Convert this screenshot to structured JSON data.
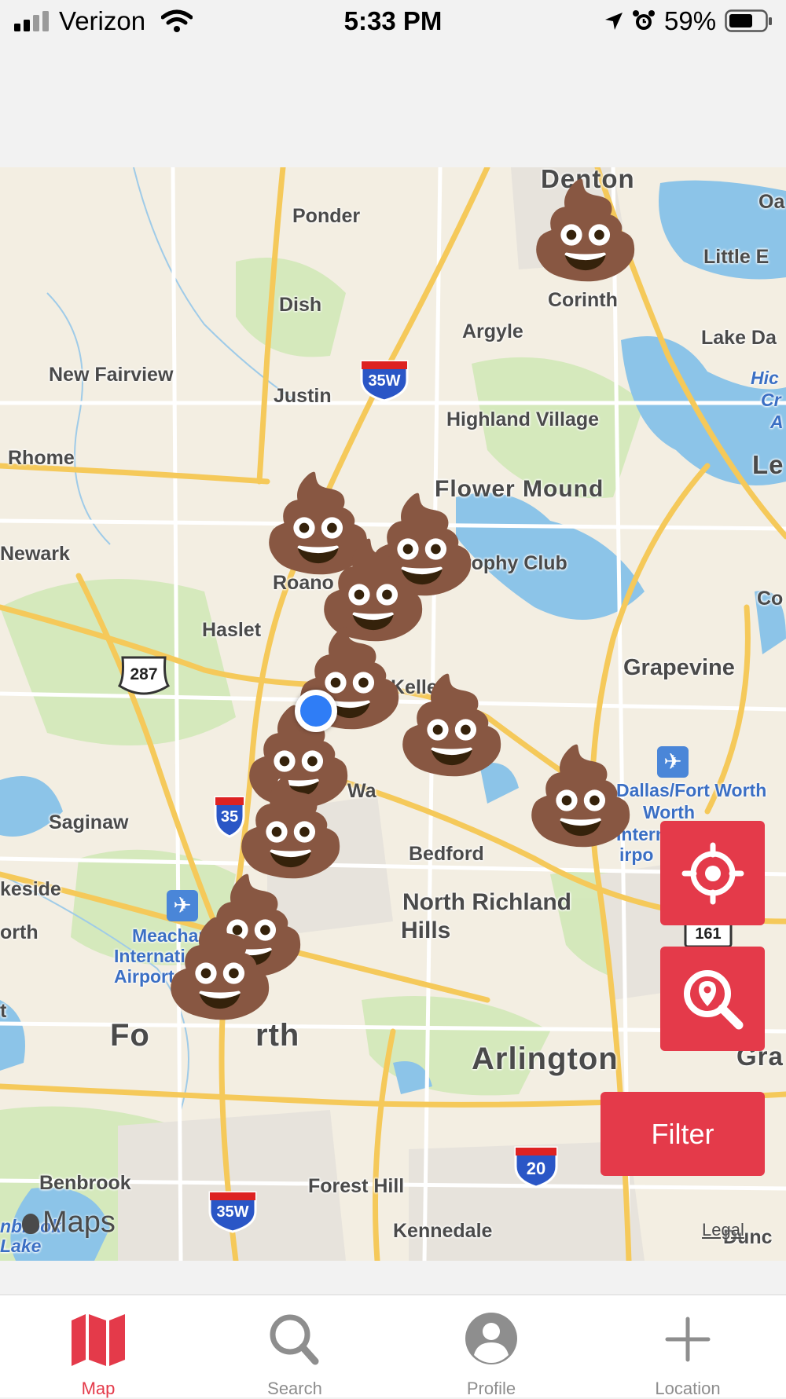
{
  "status_bar": {
    "carrier": "Verizon",
    "time": "5:33 PM",
    "battery": "59%"
  },
  "map": {
    "places": {
      "denton": "Denton",
      "ponder": "Ponder",
      "corinth": "Corinth",
      "dish": "Dish",
      "argyle": "Argyle",
      "lake_dallas": "Lake Da",
      "little_elm": "Little E",
      "oak": "Oa",
      "new_fairview": "New Fairview",
      "justin": "Justin",
      "highland_village": "Highland Village",
      "rhome": "Rhome",
      "lewisville": "Le",
      "flower_mound": "Flower Mound",
      "newark": "Newark",
      "trophy_club": "Trophy Club",
      "roanoke": "Roano",
      "coppell": "Co",
      "haslet": "Haslet",
      "grapevine": "Grapevine",
      "keller": "Keller",
      "watauga": "Wa",
      "saginaw": "Saginaw",
      "dfw_airport": "Dallas/Fort Worth",
      "dfw_airport_2": "Worth",
      "dfw_airport_3": "Intern",
      "dfw_airport_4": "irpo",
      "bedford": "Bedford",
      "lakeside": "keside",
      "north_richland_hills": "North Richland",
      "north_richland_hills_2": "Hills",
      "worth_edge": "orth",
      "meacham_1": "Meachar",
      "meacham_2": "Internati",
      "meacham_3": "Airport",
      "fort_worth": "Fo",
      "fort_worth_2": "rth",
      "arlington": "Arlington",
      "grand_prairie": "Gra",
      "benbrook": "Benbrook",
      "forest_hill": "Forest Hill",
      "kennedale": "Kennedale",
      "benbrook_lake_1": "nbrook",
      "benbrook_lake_2": "Lake",
      "hickory_1": "Hic",
      "hickory_2": "Cr",
      "hickory_3": "A",
      "duncanville": "Dunc",
      "t_edge": "t"
    },
    "shields": {
      "i35w_north": "35W",
      "i35w_mid": "35",
      "i35w_south": "35W",
      "us287": "287",
      "i20": "20",
      "sh161": "161"
    },
    "attribution": {
      "maps_logo": "Maps",
      "legal": "Legal"
    },
    "marker_icon": "pile-of-poo-emoji",
    "marker_glyph": "💩"
  },
  "controls": {
    "locate_icon": "crosshair-target-icon",
    "search_location_icon": "location-search-icon",
    "filter_label": "Filter"
  },
  "tabs": [
    {
      "label": "Map",
      "icon": "map-icon",
      "active": true
    },
    {
      "label": "Search",
      "icon": "search-icon",
      "active": false
    },
    {
      "label": "Profile",
      "icon": "profile-icon",
      "active": false
    },
    {
      "label": "Location",
      "icon": "plus-icon",
      "active": false
    }
  ],
  "colors": {
    "accent": "#e43a4a",
    "user_location": "#2f7df6",
    "highway": "#f5c95a",
    "water": "#8cc4e8",
    "park": "#cfe8b5"
  }
}
